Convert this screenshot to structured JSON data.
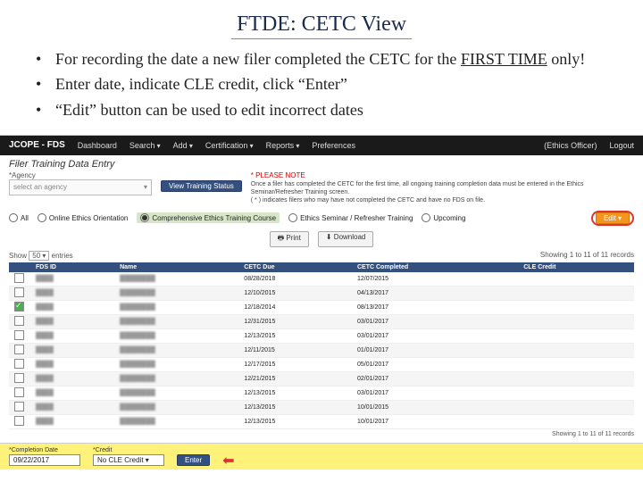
{
  "slide": {
    "title": "FTDE: CETC View",
    "bullets": [
      {
        "pre": "For recording the date a new filer completed the CETC for the ",
        "emph": "FIRST TIME",
        "post": " only!"
      },
      {
        "pre": "Enter date, indicate CLE credit, click “Enter”",
        "emph": "",
        "post": ""
      },
      {
        "pre": "“Edit” button can be used to edit incorrect dates",
        "emph": "",
        "post": ""
      }
    ]
  },
  "nav": {
    "brand": "JCOPE - FDS",
    "items": [
      "Dashboard",
      "Search",
      "Add",
      "Certification",
      "Reports",
      "Preferences"
    ],
    "user": "(Ethics Officer)",
    "logout": "Logout"
  },
  "panel": {
    "heading": "Filer Training Data Entry",
    "agency_label": "*Agency",
    "agency_placeholder": "select an agency",
    "view_status_btn": "View Training Status",
    "please_note": "* PLEASE NOTE",
    "note_line1": "Once a filer has completed the CETC for the first time, all ongoing training completion data must be entered in the Ethics Seminar/Refresher Training screen.",
    "note_line2": "( * ) indicates filers who may have not completed the CETC and have no FDS on file."
  },
  "filters": {
    "all": "All",
    "oeo": "Online Ethics Orientation",
    "cetc": "Comprehensive Ethics Training Course",
    "refresher": "Ethics Seminar / Refresher Training",
    "upcoming": "Upcoming",
    "edit": "Edit"
  },
  "toolbar": {
    "print": "Print",
    "download": "Download"
  },
  "table": {
    "show_label": "Show",
    "show_value": "50",
    "entries_label": "entries",
    "count_text": "Showing 1 to 11 of 11 records",
    "headers": [
      "FDS ID",
      "Name",
      "CETC Due",
      "CETC Completed",
      "CLE Credit"
    ],
    "rows": [
      {
        "due": "08/28/2018",
        "done": "12/07/2015"
      },
      {
        "due": "12/10/2015",
        "done": "04/13/2017"
      },
      {
        "due": "12/18/2014",
        "done": "08/13/2017"
      },
      {
        "due": "12/31/2015",
        "done": "03/01/2017"
      },
      {
        "due": "12/13/2015",
        "done": "03/01/2017"
      },
      {
        "due": "12/11/2015",
        "done": "01/01/2017"
      },
      {
        "due": "12/17/2015",
        "done": "05/01/2017"
      },
      {
        "due": "12/21/2015",
        "done": "02/01/2017"
      },
      {
        "due": "12/13/2015",
        "done": "03/01/2017"
      },
      {
        "due": "12/13/2015",
        "done": "10/01/2015"
      },
      {
        "due": "12/13/2015",
        "done": "10/01/2017"
      }
    ],
    "footer": "Showing 1 to 11 of 11 records"
  },
  "entry": {
    "date_label": "*Completion Date",
    "date_value": "09/22/2017",
    "credit_label": "*Credit",
    "credit_value": "No CLE Credit",
    "enter_btn": "Enter"
  }
}
